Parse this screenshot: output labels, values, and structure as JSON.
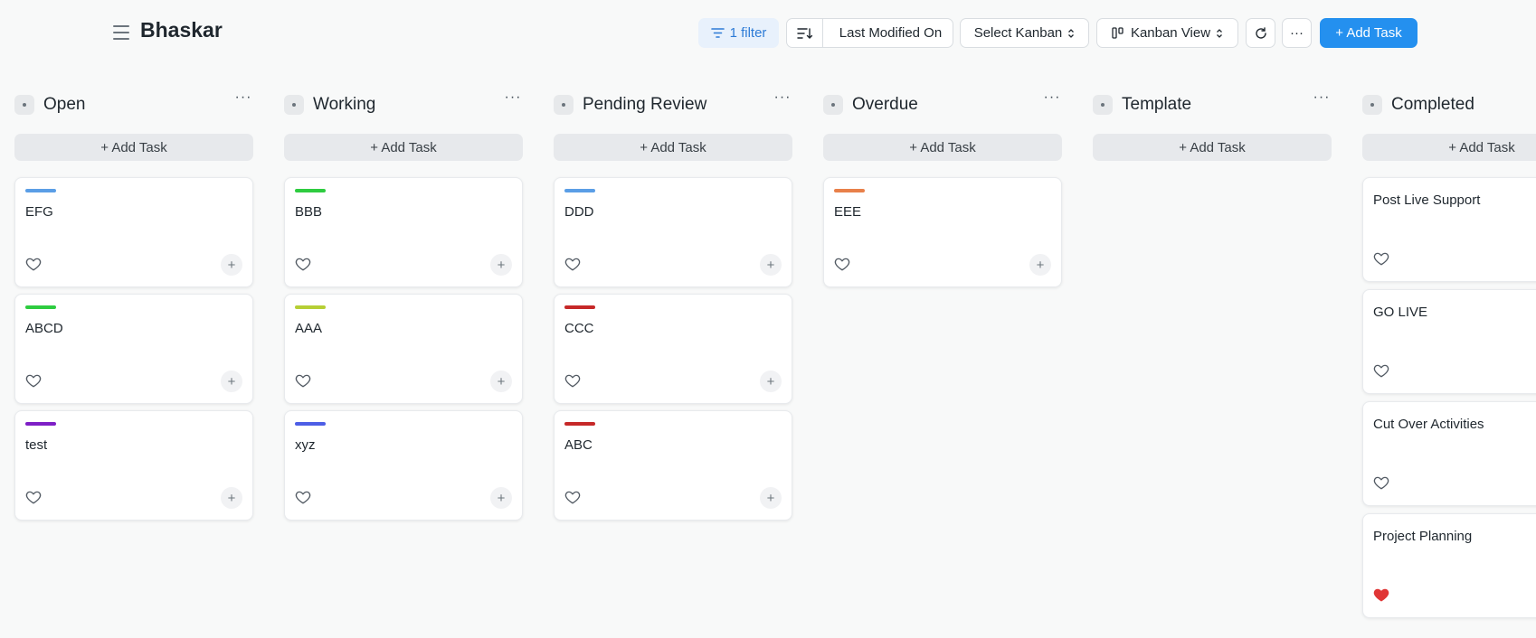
{
  "header": {
    "title": "Bhaskar",
    "filter_label": "1 filter",
    "sort_label": "Last Modified On",
    "select_kanban_label": "Select Kanban",
    "view_label": "Kanban View",
    "add_task_label": "+ Add Task",
    "more_label": "···"
  },
  "columns": [
    {
      "title": "Open",
      "add_label": "+ Add Task",
      "cards": [
        {
          "title": "EFG",
          "color": "#5a9ee6",
          "liked": false
        },
        {
          "title": "ABCD",
          "color": "#2ecc40",
          "liked": false
        },
        {
          "title": "test",
          "color": "#7e1fc6",
          "liked": false
        }
      ]
    },
    {
      "title": "Working",
      "add_label": "+ Add Task",
      "cards": [
        {
          "title": "BBB",
          "color": "#2ecc40",
          "liked": false
        },
        {
          "title": "AAA",
          "color": "#b6cf35",
          "liked": false
        },
        {
          "title": "xyz",
          "color": "#4d5ee6",
          "liked": false
        }
      ]
    },
    {
      "title": "Pending Review",
      "add_label": "+ Add Task",
      "cards": [
        {
          "title": "DDD",
          "color": "#5a9ee6",
          "liked": false
        },
        {
          "title": "CCC",
          "color": "#c62828",
          "liked": false
        },
        {
          "title": "ABC",
          "color": "#c62828",
          "liked": false
        }
      ]
    },
    {
      "title": "Overdue",
      "add_label": "+ Add Task",
      "cards": [
        {
          "title": "EEE",
          "color": "#e8804a",
          "liked": false
        }
      ]
    },
    {
      "title": "Template",
      "add_label": "+ Add Task",
      "cards": []
    },
    {
      "title": "Completed",
      "add_label": "+ Add Task",
      "cards": [
        {
          "title": "Post Live Support",
          "color": "",
          "liked": false
        },
        {
          "title": "GO LIVE",
          "color": "",
          "liked": false
        },
        {
          "title": "Cut Over Activities",
          "color": "",
          "liked": false
        },
        {
          "title": "Project Planning",
          "color": "",
          "liked": true
        }
      ]
    }
  ],
  "colors": {
    "primary": "#2490ef",
    "like": "#e03636"
  }
}
